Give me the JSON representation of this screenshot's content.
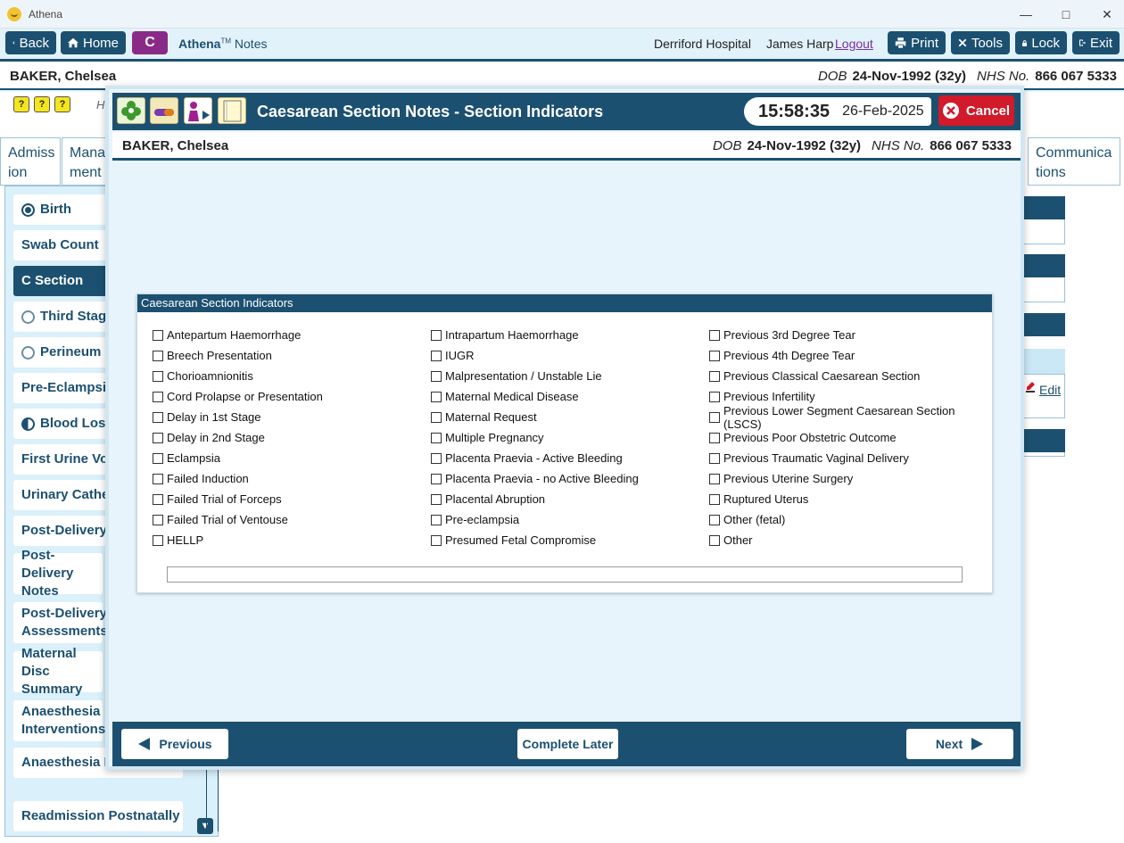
{
  "window": {
    "title": "Athena"
  },
  "toolbar": {
    "back": "Back",
    "home": "Home",
    "c_badge": "C",
    "brand": "Athena",
    "brand_tm": "TM",
    "brand_sub": "Notes",
    "hospital": "Derriford Hospital",
    "user": "James Harp",
    "logout": "Logout",
    "print": "Print",
    "tools": "Tools",
    "lock": "Lock",
    "exit": "Exit"
  },
  "patient": {
    "name": "BAKER, Chelsea",
    "dob_label": "DOB",
    "dob": "24-Nov-1992 (32y)",
    "nhs_label": "NHS No.",
    "nhs": "866 067 5333"
  },
  "background": {
    "mini_icons": [
      "?",
      "?",
      "?"
    ],
    "h_letter": "H",
    "tabs": {
      "admission": "Admiss ion",
      "management": "Mana ment",
      "communications": "Communica tions"
    },
    "nav": [
      "Birth",
      "Swab Count",
      "C Section",
      "Third Stage",
      "Perineum",
      "Pre-Eclampsia",
      "Blood Loss",
      "First Urine Voi",
      "Urinary Cathe",
      "Post-Delivery",
      "Post-Delivery Notes",
      "Post-Delivery Assessments",
      "Maternal Disc Summary",
      "Anaesthesia Interventions",
      "Anaesthesia Fo",
      "Readmission Postnatally"
    ],
    "edit": "Edit"
  },
  "modal": {
    "title": "Caesarean Section Notes - Section Indicators",
    "time": "15:58:35",
    "date": "26-Feb-2025",
    "cancel": "Cancel",
    "previous": "Previous",
    "complete_later": "Complete Later",
    "next": "Next"
  },
  "indicators": {
    "header": "Caesarean Section Indicators",
    "col1": [
      "Antepartum Haemorrhage",
      "Breech Presentation",
      "Chorioamnionitis",
      "Cord Prolapse or Presentation",
      "Delay in 1st Stage",
      "Delay in 2nd Stage",
      "Eclampsia",
      "Failed Induction",
      "Failed Trial of Forceps",
      "Failed Trial of Ventouse",
      "HELLP"
    ],
    "col2": [
      "Intrapartum Haemorrhage",
      "IUGR",
      "Malpresentation / Unstable Lie",
      "Maternal Medical Disease",
      "Maternal Request",
      "Multiple Pregnancy",
      "Placenta Praevia - Active Bleeding",
      "Placenta Praevia - no Active Bleeding",
      "Placental Abruption",
      "Pre-eclampsia",
      "Presumed Fetal Compromise"
    ],
    "col3": [
      "Previous 3rd Degree Tear",
      "Previous 4th Degree Tear",
      "Previous Classical Caesarean Section",
      "Previous Infertility",
      "Previous Lower Segment Caesarean Section (LSCS)",
      "Previous Poor Obstetric Outcome",
      "Previous Traumatic Vaginal Delivery",
      "Previous Uterine Surgery",
      "Ruptured Uterus",
      "Other (fetal)",
      "Other"
    ],
    "other_text": ""
  }
}
